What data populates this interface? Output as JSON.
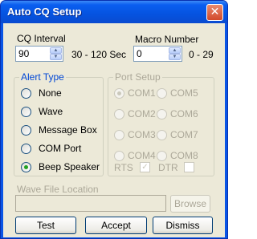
{
  "window": {
    "title": "Auto CQ Setup"
  },
  "cq_interval": {
    "label": "CQ Interval",
    "value": "90",
    "range": "30 - 120 Sec"
  },
  "macro_number": {
    "label": "Macro Number",
    "value": "0",
    "range": "0 - 29"
  },
  "alert_type": {
    "title": "Alert Type",
    "options": [
      {
        "label": "None",
        "selected": false
      },
      {
        "label": "Wave",
        "selected": false
      },
      {
        "label": "Message Box",
        "selected": false
      },
      {
        "label": "COM Port",
        "selected": false
      },
      {
        "label": "Beep Speaker",
        "selected": true
      }
    ]
  },
  "port_setup": {
    "title": "Port Setup",
    "ports": [
      "COM1",
      "COM5",
      "COM2",
      "COM6",
      "COM3",
      "COM7",
      "COM4",
      "COM8"
    ],
    "selected": "COM1",
    "rts_label": "RTS",
    "rts_checked": true,
    "dtr_label": "DTR",
    "dtr_checked": false
  },
  "wave_file": {
    "label": "Wave File Location",
    "value": "",
    "browse_label": "Browse"
  },
  "buttons": {
    "test": "Test",
    "accept": "Accept",
    "dismiss": "Dismiss"
  },
  "icons": {
    "close": "close-icon",
    "spin_up": "arrow-up-icon",
    "spin_down": "arrow-down-icon"
  },
  "colors": {
    "titlebar": "#0a5ef0",
    "close": "#d2492a",
    "face": "#ece9d8",
    "selected_dot": "#21a121"
  }
}
